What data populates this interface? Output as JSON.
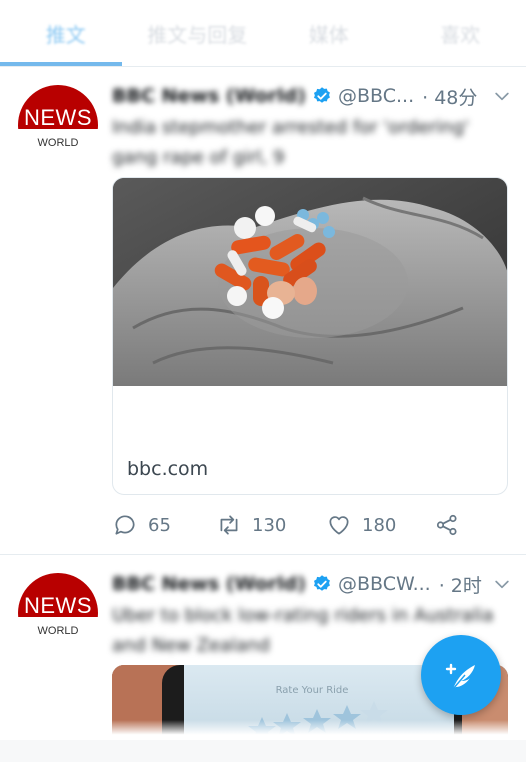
{
  "tabs": [
    {
      "label": "推文",
      "active": true
    },
    {
      "label": "推文与回复",
      "active": false
    },
    {
      "label": "媒体",
      "active": false
    },
    {
      "label": "喜欢",
      "active": false
    }
  ],
  "avatar": {
    "top_text": "NEWS",
    "bottom_text": "WORLD",
    "color": "#b80000"
  },
  "tweets": [
    {
      "name": "BBC News (World)",
      "handle": "@BBC...",
      "time": "· 48分",
      "text": "India stepmother arrested for 'ordering' gang rape of girl, 9",
      "card": {
        "domain": "bbc.com"
      },
      "actions": {
        "replies": "65",
        "retweets": "130",
        "likes": "180"
      }
    },
    {
      "name": "BBC News (World)",
      "handle": "@BBCW...",
      "time": "· 2时",
      "text": "Uber to block low-rating riders in Australia and New Zealand",
      "card": {
        "caption": "Rate Your Ride"
      }
    }
  ],
  "colors": {
    "accent": "#1da1f2",
    "verified": "#1da1f2",
    "brand": "#b80000"
  },
  "icons": [
    "reply-icon",
    "retweet-icon",
    "like-icon",
    "share-icon",
    "verified-badge-icon",
    "chevron-down-icon",
    "compose-tweet-icon"
  ]
}
